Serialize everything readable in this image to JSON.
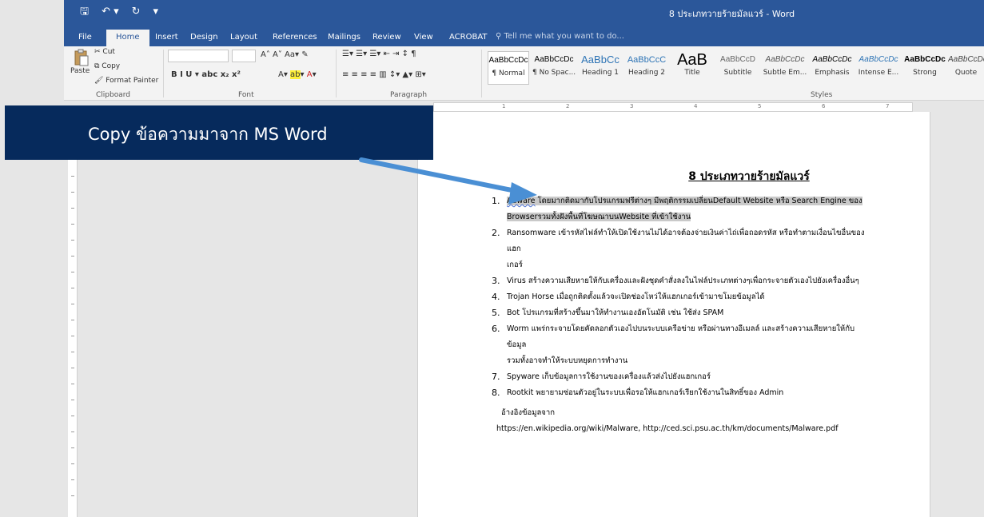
{
  "window": {
    "title": "8 ประเภทวายร้ายมัลแวร์ - Word",
    "qat": [
      "🖫",
      "↶ ▾",
      "↻",
      "▾"
    ]
  },
  "tabs": [
    "File",
    "Home",
    "Insert",
    "Design",
    "Layout",
    "References",
    "Mailings",
    "Review",
    "View",
    "ACROBAT"
  ],
  "tell_me": "Tell me what you want to do...",
  "ribbon": {
    "clipboard": {
      "paste": "Paste",
      "cut": "Cut",
      "copy": "Copy",
      "format_painter": "Format Painter",
      "label": "Clipboard"
    },
    "font": {
      "label": "Font"
    },
    "paragraph": {
      "label": "Paragraph"
    },
    "styles": {
      "label": "Styles",
      "items": [
        {
          "preview": "AaBbCcDc",
          "name": "¶ Normal"
        },
        {
          "preview": "AaBbCcDc",
          "name": "¶ No Spac..."
        },
        {
          "preview": "AaBbCc",
          "name": "Heading 1"
        },
        {
          "preview": "AaBbCcC",
          "name": "Heading 2"
        },
        {
          "preview": "AaB",
          "name": "Title"
        },
        {
          "preview": "AaBbCcD",
          "name": "Subtitle"
        },
        {
          "preview": "AaBbCcDc",
          "name": "Subtle Em..."
        },
        {
          "preview": "AaBbCcDc",
          "name": "Emphasis"
        },
        {
          "preview": "AaBbCcDc",
          "name": "Intense E..."
        },
        {
          "preview": "AaBbCcDc",
          "name": "Strong"
        },
        {
          "preview": "AaBbCcDc",
          "name": "Quote"
        }
      ]
    }
  },
  "ruler": [
    "1",
    "2",
    "3",
    "4",
    "5",
    "6",
    "7"
  ],
  "callout": "Copy ข้อความมาจาก MS Word",
  "document": {
    "title": "8 ประเภทวายร้ายมัลแวร์",
    "items": [
      {
        "num": "1.",
        "head": "Adware",
        "text": "โดยมากติดมากับโปรแกรมฟรีต่างๆ มีพฤติกรรมเปลี่ยนDefault Website หรือ Search Engine ของ",
        "text2": "Browserรวมทั้งฝังพื้นที่โฆษณาบนWebsite ที่เข้าใช้งาน"
      },
      {
        "num": "2.",
        "text": "Ransomware เข้ารหัสไฟล์ทำให้เปิดใช้งานไม่ได้อาจต้องจ่ายเงินค่าไถ่เพื่อถอดรหัส หรือทำตามเงื่อนไขอื่นของแฮก",
        "text2": "เกอร์"
      },
      {
        "num": "3.",
        "text": "Virus สร้างความเสียหายให้กับเครื่องและฝังชุดคำสั่งลงในไฟล์ประเภทต่างๆเพื่อกระจายตัวเองไปยังเครื่องอื่นๆ"
      },
      {
        "num": "4.",
        "text": "Trojan Horse เมื่อถูกติดตั้งแล้วจะเปิดช่องโหว่ให้แฮกเกอร์เข้ามาขโมยข้อมูลได้"
      },
      {
        "num": "5.",
        "text": "Bot โปรแกรมที่สร้างขึ้นมาให้ทำงานเองอัตโนมัติ เช่น ใช้ส่ง SPAM"
      },
      {
        "num": "6.",
        "text": "Worm แพร่กระจายโดยคัดลอกตัวเองไปบนระบบเครือข่าย หรือผ่านทางอีเมลล์ และสร้างความเสียหายให้กับข้อมูล",
        "text2": "รวมทั้งอาจทำให้ระบบหยุดการทำงาน"
      },
      {
        "num": "7.",
        "text": "Spyware เก็บข้อมูลการใช้งานของเครื่องแล้วส่งไปยังแฮกเกอร์"
      },
      {
        "num": "8.",
        "text": "Rootkit พยายามซ่อนตัวอยู่ในระบบเพื่อรอให้แฮกเกอร์เรียกใช้งานในสิทธิ์ของ Admin"
      }
    ],
    "ref_label": "อ้างอิงข้อมูลจาก",
    "ref_links": "https://en.wikipedia.org/wiki/Malware, http://ced.sci.psu.ac.th/km/documents/Malware.pdf"
  },
  "colors": {
    "word_blue": "#2b579a",
    "callout_bg": "#062a5c",
    "arrow": "#4a8fd4"
  }
}
